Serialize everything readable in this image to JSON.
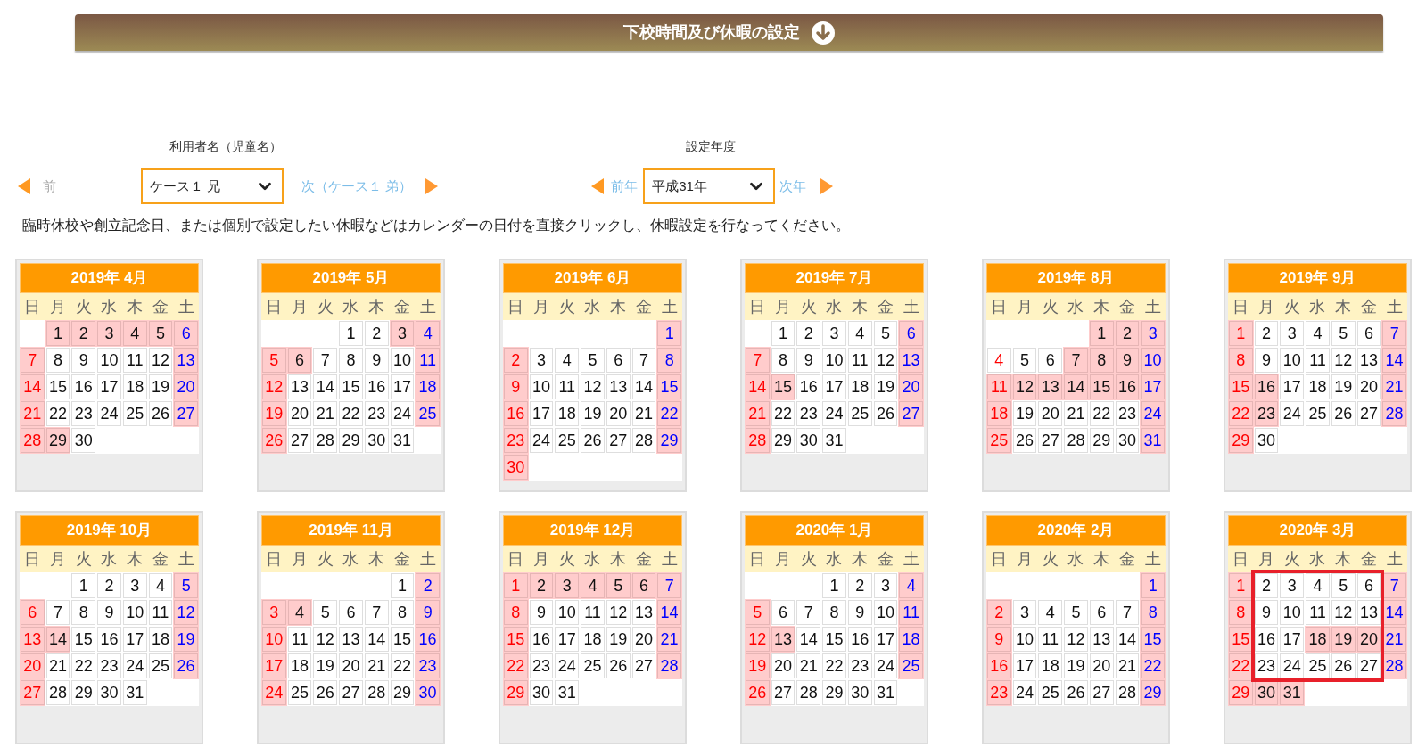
{
  "header": {
    "title": "下校時間及び休暇の設定"
  },
  "user": {
    "label": "利用者名（児童名）",
    "prev": "前",
    "value": "ケース１ 兄",
    "next": "次（ケース１ 弟）"
  },
  "year": {
    "label": "設定年度",
    "prev": "前年",
    "value": "平成31年",
    "next": "次年"
  },
  "instruction": "臨時休校や創立記念日、または個別で設定したい休暇などはカレンダーの日付を直接クリックし、休暇設定を行なってください。",
  "months": [
    {
      "title": "2019年 4月",
      "weekdays": [
        "日",
        "月",
        "火",
        "水",
        "木",
        "金",
        "土"
      ],
      "days": [
        {
          "kind": "blank"
        },
        {
          "kind": "day",
          "day": "1",
          "holiday": true
        },
        {
          "kind": "day",
          "day": "2",
          "holiday": true
        },
        {
          "kind": "day",
          "day": "3",
          "holiday": true
        },
        {
          "kind": "day",
          "day": "4",
          "holiday": true
        },
        {
          "kind": "day",
          "day": "5",
          "holiday": true
        },
        {
          "kind": "day",
          "day": "6",
          "holiday": true
        },
        {
          "kind": "day",
          "day": "7",
          "holiday": true
        },
        {
          "kind": "day",
          "day": "8",
          "holiday": false
        },
        {
          "kind": "day",
          "day": "9",
          "holiday": false
        },
        {
          "kind": "day",
          "day": "10",
          "holiday": false
        },
        {
          "kind": "day",
          "day": "11",
          "holiday": false
        },
        {
          "kind": "day",
          "day": "12",
          "holiday": false
        },
        {
          "kind": "day",
          "day": "13",
          "holiday": true
        },
        {
          "kind": "day",
          "day": "14",
          "holiday": true
        },
        {
          "kind": "day",
          "day": "15",
          "holiday": false
        },
        {
          "kind": "day",
          "day": "16",
          "holiday": false
        },
        {
          "kind": "day",
          "day": "17",
          "holiday": false
        },
        {
          "kind": "day",
          "day": "18",
          "holiday": false
        },
        {
          "kind": "day",
          "day": "19",
          "holiday": false
        },
        {
          "kind": "day",
          "day": "20",
          "holiday": true
        },
        {
          "kind": "day",
          "day": "21",
          "holiday": true
        },
        {
          "kind": "day",
          "day": "22",
          "holiday": false
        },
        {
          "kind": "day",
          "day": "23",
          "holiday": false
        },
        {
          "kind": "day",
          "day": "24",
          "holiday": false
        },
        {
          "kind": "day",
          "day": "25",
          "holiday": false
        },
        {
          "kind": "day",
          "day": "26",
          "holiday": false
        },
        {
          "kind": "day",
          "day": "27",
          "holiday": true
        },
        {
          "kind": "day",
          "day": "28",
          "holiday": true
        },
        {
          "kind": "day",
          "day": "29",
          "holiday": true
        },
        {
          "kind": "day",
          "day": "30",
          "holiday": false
        }
      ]
    },
    {
      "title": "2019年 5月",
      "weekdays": [
        "日",
        "月",
        "火",
        "水",
        "木",
        "金",
        "土"
      ],
      "days": [
        {
          "kind": "blank"
        },
        {
          "kind": "blank"
        },
        {
          "kind": "blank"
        },
        {
          "kind": "day",
          "day": "1",
          "holiday": false
        },
        {
          "kind": "day",
          "day": "2",
          "holiday": false
        },
        {
          "kind": "day",
          "day": "3",
          "holiday": true
        },
        {
          "kind": "day",
          "day": "4",
          "holiday": true
        },
        {
          "kind": "day",
          "day": "5",
          "holiday": true
        },
        {
          "kind": "day",
          "day": "6",
          "holiday": true
        },
        {
          "kind": "day",
          "day": "7",
          "holiday": false
        },
        {
          "kind": "day",
          "day": "8",
          "holiday": false
        },
        {
          "kind": "day",
          "day": "9",
          "holiday": false
        },
        {
          "kind": "day",
          "day": "10",
          "holiday": false
        },
        {
          "kind": "day",
          "day": "11",
          "holiday": true
        },
        {
          "kind": "day",
          "day": "12",
          "holiday": true
        },
        {
          "kind": "day",
          "day": "13",
          "holiday": false
        },
        {
          "kind": "day",
          "day": "14",
          "holiday": false
        },
        {
          "kind": "day",
          "day": "15",
          "holiday": false
        },
        {
          "kind": "day",
          "day": "16",
          "holiday": false
        },
        {
          "kind": "day",
          "day": "17",
          "holiday": false
        },
        {
          "kind": "day",
          "day": "18",
          "holiday": true
        },
        {
          "kind": "day",
          "day": "19",
          "holiday": true
        },
        {
          "kind": "day",
          "day": "20",
          "holiday": false
        },
        {
          "kind": "day",
          "day": "21",
          "holiday": false
        },
        {
          "kind": "day",
          "day": "22",
          "holiday": false
        },
        {
          "kind": "day",
          "day": "23",
          "holiday": false
        },
        {
          "kind": "day",
          "day": "24",
          "holiday": false
        },
        {
          "kind": "day",
          "day": "25",
          "holiday": true
        },
        {
          "kind": "day",
          "day": "26",
          "holiday": true
        },
        {
          "kind": "day",
          "day": "27",
          "holiday": false
        },
        {
          "kind": "day",
          "day": "28",
          "holiday": false
        },
        {
          "kind": "day",
          "day": "29",
          "holiday": false
        },
        {
          "kind": "day",
          "day": "30",
          "holiday": false
        },
        {
          "kind": "day",
          "day": "31",
          "holiday": false
        }
      ]
    },
    {
      "title": "2019年 6月",
      "weekdays": [
        "日",
        "月",
        "火",
        "水",
        "木",
        "金",
        "土"
      ],
      "days": [
        {
          "kind": "blank"
        },
        {
          "kind": "blank"
        },
        {
          "kind": "blank"
        },
        {
          "kind": "blank"
        },
        {
          "kind": "blank"
        },
        {
          "kind": "blank"
        },
        {
          "kind": "day",
          "day": "1",
          "holiday": true
        },
        {
          "kind": "day",
          "day": "2",
          "holiday": true
        },
        {
          "kind": "day",
          "day": "3",
          "holiday": false
        },
        {
          "kind": "day",
          "day": "4",
          "holiday": false
        },
        {
          "kind": "day",
          "day": "5",
          "holiday": false
        },
        {
          "kind": "day",
          "day": "6",
          "holiday": false
        },
        {
          "kind": "day",
          "day": "7",
          "holiday": false
        },
        {
          "kind": "day",
          "day": "8",
          "holiday": true
        },
        {
          "kind": "day",
          "day": "9",
          "holiday": true
        },
        {
          "kind": "day",
          "day": "10",
          "holiday": false
        },
        {
          "kind": "day",
          "day": "11",
          "holiday": false
        },
        {
          "kind": "day",
          "day": "12",
          "holiday": false
        },
        {
          "kind": "day",
          "day": "13",
          "holiday": false
        },
        {
          "kind": "day",
          "day": "14",
          "holiday": false
        },
        {
          "kind": "day",
          "day": "15",
          "holiday": true
        },
        {
          "kind": "day",
          "day": "16",
          "holiday": true
        },
        {
          "kind": "day",
          "day": "17",
          "holiday": false
        },
        {
          "kind": "day",
          "day": "18",
          "holiday": false
        },
        {
          "kind": "day",
          "day": "19",
          "holiday": false
        },
        {
          "kind": "day",
          "day": "20",
          "holiday": false
        },
        {
          "kind": "day",
          "day": "21",
          "holiday": false
        },
        {
          "kind": "day",
          "day": "22",
          "holiday": true
        },
        {
          "kind": "day",
          "day": "23",
          "holiday": true
        },
        {
          "kind": "day",
          "day": "24",
          "holiday": false
        },
        {
          "kind": "day",
          "day": "25",
          "holiday": false
        },
        {
          "kind": "day",
          "day": "26",
          "holiday": false
        },
        {
          "kind": "day",
          "day": "27",
          "holiday": false
        },
        {
          "kind": "day",
          "day": "28",
          "holiday": false
        },
        {
          "kind": "day",
          "day": "29",
          "holiday": true
        },
        {
          "kind": "day",
          "day": "30",
          "holiday": true
        }
      ]
    },
    {
      "title": "2019年 7月",
      "weekdays": [
        "日",
        "月",
        "火",
        "水",
        "木",
        "金",
        "土"
      ],
      "days": [
        {
          "kind": "blank"
        },
        {
          "kind": "day",
          "day": "1",
          "holiday": false
        },
        {
          "kind": "day",
          "day": "2",
          "holiday": false
        },
        {
          "kind": "day",
          "day": "3",
          "holiday": false
        },
        {
          "kind": "day",
          "day": "4",
          "holiday": false
        },
        {
          "kind": "day",
          "day": "5",
          "holiday": false
        },
        {
          "kind": "day",
          "day": "6",
          "holiday": true
        },
        {
          "kind": "day",
          "day": "7",
          "holiday": true
        },
        {
          "kind": "day",
          "day": "8",
          "holiday": false
        },
        {
          "kind": "day",
          "day": "9",
          "holiday": false
        },
        {
          "kind": "day",
          "day": "10",
          "holiday": false
        },
        {
          "kind": "day",
          "day": "11",
          "holiday": false
        },
        {
          "kind": "day",
          "day": "12",
          "holiday": false
        },
        {
          "kind": "day",
          "day": "13",
          "holiday": true
        },
        {
          "kind": "day",
          "day": "14",
          "holiday": true
        },
        {
          "kind": "day",
          "day": "15",
          "holiday": true
        },
        {
          "kind": "day",
          "day": "16",
          "holiday": false
        },
        {
          "kind": "day",
          "day": "17",
          "holiday": false
        },
        {
          "kind": "day",
          "day": "18",
          "holiday": false
        },
        {
          "kind": "day",
          "day": "19",
          "holiday": false
        },
        {
          "kind": "day",
          "day": "20",
          "holiday": true
        },
        {
          "kind": "day",
          "day": "21",
          "holiday": true
        },
        {
          "kind": "day",
          "day": "22",
          "holiday": false
        },
        {
          "kind": "day",
          "day": "23",
          "holiday": false
        },
        {
          "kind": "day",
          "day": "24",
          "holiday": false
        },
        {
          "kind": "day",
          "day": "25",
          "holiday": false
        },
        {
          "kind": "day",
          "day": "26",
          "holiday": false
        },
        {
          "kind": "day",
          "day": "27",
          "holiday": true
        },
        {
          "kind": "day",
          "day": "28",
          "holiday": true
        },
        {
          "kind": "day",
          "day": "29",
          "holiday": false
        },
        {
          "kind": "day",
          "day": "30",
          "holiday": false
        },
        {
          "kind": "day",
          "day": "31",
          "holiday": false
        }
      ]
    },
    {
      "title": "2019年 8月",
      "weekdays": [
        "日",
        "月",
        "火",
        "水",
        "木",
        "金",
        "土"
      ],
      "days": [
        {
          "kind": "blank"
        },
        {
          "kind": "blank"
        },
        {
          "kind": "blank"
        },
        {
          "kind": "blank"
        },
        {
          "kind": "day",
          "day": "1",
          "holiday": true
        },
        {
          "kind": "day",
          "day": "2",
          "holiday": true
        },
        {
          "kind": "day",
          "day": "3",
          "holiday": true
        },
        {
          "kind": "day",
          "day": "4",
          "holiday": false
        },
        {
          "kind": "day",
          "day": "5",
          "holiday": false
        },
        {
          "kind": "day",
          "day": "6",
          "holiday": false
        },
        {
          "kind": "day",
          "day": "7",
          "holiday": true
        },
        {
          "kind": "day",
          "day": "8",
          "holiday": true
        },
        {
          "kind": "day",
          "day": "9",
          "holiday": true
        },
        {
          "kind": "day",
          "day": "10",
          "holiday": true
        },
        {
          "kind": "day",
          "day": "11",
          "holiday": true
        },
        {
          "kind": "day",
          "day": "12",
          "holiday": true
        },
        {
          "kind": "day",
          "day": "13",
          "holiday": true
        },
        {
          "kind": "day",
          "day": "14",
          "holiday": true
        },
        {
          "kind": "day",
          "day": "15",
          "holiday": true
        },
        {
          "kind": "day",
          "day": "16",
          "holiday": true
        },
        {
          "kind": "day",
          "day": "17",
          "holiday": true
        },
        {
          "kind": "day",
          "day": "18",
          "holiday": true
        },
        {
          "kind": "day",
          "day": "19",
          "holiday": false
        },
        {
          "kind": "day",
          "day": "20",
          "holiday": false
        },
        {
          "kind": "day",
          "day": "21",
          "holiday": false
        },
        {
          "kind": "day",
          "day": "22",
          "holiday": false
        },
        {
          "kind": "day",
          "day": "23",
          "holiday": false
        },
        {
          "kind": "day",
          "day": "24",
          "holiday": true
        },
        {
          "kind": "day",
          "day": "25",
          "holiday": true
        },
        {
          "kind": "day",
          "day": "26",
          "holiday": false
        },
        {
          "kind": "day",
          "day": "27",
          "holiday": false
        },
        {
          "kind": "day",
          "day": "28",
          "holiday": false
        },
        {
          "kind": "day",
          "day": "29",
          "holiday": false
        },
        {
          "kind": "day",
          "day": "30",
          "holiday": false
        },
        {
          "kind": "day",
          "day": "31",
          "holiday": true
        }
      ]
    },
    {
      "title": "2019年 9月",
      "weekdays": [
        "日",
        "月",
        "火",
        "水",
        "木",
        "金",
        "土"
      ],
      "days": [
        {
          "kind": "day",
          "day": "1",
          "holiday": true
        },
        {
          "kind": "day",
          "day": "2",
          "holiday": false
        },
        {
          "kind": "day",
          "day": "3",
          "holiday": false
        },
        {
          "kind": "day",
          "day": "4",
          "holiday": false
        },
        {
          "kind": "day",
          "day": "5",
          "holiday": false
        },
        {
          "kind": "day",
          "day": "6",
          "holiday": false
        },
        {
          "kind": "day",
          "day": "7",
          "holiday": true
        },
        {
          "kind": "day",
          "day": "8",
          "holiday": true
        },
        {
          "kind": "day",
          "day": "9",
          "holiday": false
        },
        {
          "kind": "day",
          "day": "10",
          "holiday": false
        },
        {
          "kind": "day",
          "day": "11",
          "holiday": false
        },
        {
          "kind": "day",
          "day": "12",
          "holiday": false
        },
        {
          "kind": "day",
          "day": "13",
          "holiday": false
        },
        {
          "kind": "day",
          "day": "14",
          "holiday": true
        },
        {
          "kind": "day",
          "day": "15",
          "holiday": true
        },
        {
          "kind": "day",
          "day": "16",
          "holiday": true
        },
        {
          "kind": "day",
          "day": "17",
          "holiday": false
        },
        {
          "kind": "day",
          "day": "18",
          "holiday": false
        },
        {
          "kind": "day",
          "day": "19",
          "holiday": false
        },
        {
          "kind": "day",
          "day": "20",
          "holiday": false
        },
        {
          "kind": "day",
          "day": "21",
          "holiday": true
        },
        {
          "kind": "day",
          "day": "22",
          "holiday": true
        },
        {
          "kind": "day",
          "day": "23",
          "holiday": true
        },
        {
          "kind": "day",
          "day": "24",
          "holiday": false
        },
        {
          "kind": "day",
          "day": "25",
          "holiday": false
        },
        {
          "kind": "day",
          "day": "26",
          "holiday": false
        },
        {
          "kind": "day",
          "day": "27",
          "holiday": false
        },
        {
          "kind": "day",
          "day": "28",
          "holiday": true
        },
        {
          "kind": "day",
          "day": "29",
          "holiday": true
        },
        {
          "kind": "day",
          "day": "30",
          "holiday": false
        }
      ]
    },
    {
      "title": "2019年 10月",
      "weekdays": [
        "日",
        "月",
        "火",
        "水",
        "木",
        "金",
        "土"
      ],
      "days": [
        {
          "kind": "blank"
        },
        {
          "kind": "blank"
        },
        {
          "kind": "day",
          "day": "1",
          "holiday": false
        },
        {
          "kind": "day",
          "day": "2",
          "holiday": false
        },
        {
          "kind": "day",
          "day": "3",
          "holiday": false
        },
        {
          "kind": "day",
          "day": "4",
          "holiday": false
        },
        {
          "kind": "day",
          "day": "5",
          "holiday": true
        },
        {
          "kind": "day",
          "day": "6",
          "holiday": true
        },
        {
          "kind": "day",
          "day": "7",
          "holiday": false
        },
        {
          "kind": "day",
          "day": "8",
          "holiday": false
        },
        {
          "kind": "day",
          "day": "9",
          "holiday": false
        },
        {
          "kind": "day",
          "day": "10",
          "holiday": false
        },
        {
          "kind": "day",
          "day": "11",
          "holiday": false
        },
        {
          "kind": "day",
          "day": "12",
          "holiday": true
        },
        {
          "kind": "day",
          "day": "13",
          "holiday": true
        },
        {
          "kind": "day",
          "day": "14",
          "holiday": true
        },
        {
          "kind": "day",
          "day": "15",
          "holiday": false
        },
        {
          "kind": "day",
          "day": "16",
          "holiday": false
        },
        {
          "kind": "day",
          "day": "17",
          "holiday": false
        },
        {
          "kind": "day",
          "day": "18",
          "holiday": false
        },
        {
          "kind": "day",
          "day": "19",
          "holiday": true
        },
        {
          "kind": "day",
          "day": "20",
          "holiday": true
        },
        {
          "kind": "day",
          "day": "21",
          "holiday": false
        },
        {
          "kind": "day",
          "day": "22",
          "holiday": false
        },
        {
          "kind": "day",
          "day": "23",
          "holiday": false
        },
        {
          "kind": "day",
          "day": "24",
          "holiday": false
        },
        {
          "kind": "day",
          "day": "25",
          "holiday": false
        },
        {
          "kind": "day",
          "day": "26",
          "holiday": true
        },
        {
          "kind": "day",
          "day": "27",
          "holiday": true
        },
        {
          "kind": "day",
          "day": "28",
          "holiday": false
        },
        {
          "kind": "day",
          "day": "29",
          "holiday": false
        },
        {
          "kind": "day",
          "day": "30",
          "holiday": false
        },
        {
          "kind": "day",
          "day": "31",
          "holiday": false
        }
      ]
    },
    {
      "title": "2019年 11月",
      "weekdays": [
        "日",
        "月",
        "火",
        "水",
        "木",
        "金",
        "土"
      ],
      "days": [
        {
          "kind": "blank"
        },
        {
          "kind": "blank"
        },
        {
          "kind": "blank"
        },
        {
          "kind": "blank"
        },
        {
          "kind": "blank"
        },
        {
          "kind": "day",
          "day": "1",
          "holiday": false
        },
        {
          "kind": "day",
          "day": "2",
          "holiday": true
        },
        {
          "kind": "day",
          "day": "3",
          "holiday": true
        },
        {
          "kind": "day",
          "day": "4",
          "holiday": true
        },
        {
          "kind": "day",
          "day": "5",
          "holiday": false
        },
        {
          "kind": "day",
          "day": "6",
          "holiday": false
        },
        {
          "kind": "day",
          "day": "7",
          "holiday": false
        },
        {
          "kind": "day",
          "day": "8",
          "holiday": false
        },
        {
          "kind": "day",
          "day": "9",
          "holiday": true
        },
        {
          "kind": "day",
          "day": "10",
          "holiday": true
        },
        {
          "kind": "day",
          "day": "11",
          "holiday": false
        },
        {
          "kind": "day",
          "day": "12",
          "holiday": false
        },
        {
          "kind": "day",
          "day": "13",
          "holiday": false
        },
        {
          "kind": "day",
          "day": "14",
          "holiday": false
        },
        {
          "kind": "day",
          "day": "15",
          "holiday": false
        },
        {
          "kind": "day",
          "day": "16",
          "holiday": true
        },
        {
          "kind": "day",
          "day": "17",
          "holiday": true
        },
        {
          "kind": "day",
          "day": "18",
          "holiday": false
        },
        {
          "kind": "day",
          "day": "19",
          "holiday": false
        },
        {
          "kind": "day",
          "day": "20",
          "holiday": false
        },
        {
          "kind": "day",
          "day": "21",
          "holiday": false
        },
        {
          "kind": "day",
          "day": "22",
          "holiday": false
        },
        {
          "kind": "day",
          "day": "23",
          "holiday": true
        },
        {
          "kind": "day",
          "day": "24",
          "holiday": true
        },
        {
          "kind": "day",
          "day": "25",
          "holiday": false
        },
        {
          "kind": "day",
          "day": "26",
          "holiday": false
        },
        {
          "kind": "day",
          "day": "27",
          "holiday": false
        },
        {
          "kind": "day",
          "day": "28",
          "holiday": false
        },
        {
          "kind": "day",
          "day": "29",
          "holiday": false
        },
        {
          "kind": "day",
          "day": "30",
          "holiday": true
        }
      ]
    },
    {
      "title": "2019年 12月",
      "weekdays": [
        "日",
        "月",
        "火",
        "水",
        "木",
        "金",
        "土"
      ],
      "days": [
        {
          "kind": "day",
          "day": "1",
          "holiday": true
        },
        {
          "kind": "day",
          "day": "2",
          "holiday": true
        },
        {
          "kind": "day",
          "day": "3",
          "holiday": true
        },
        {
          "kind": "day",
          "day": "4",
          "holiday": true
        },
        {
          "kind": "day",
          "day": "5",
          "holiday": true
        },
        {
          "kind": "day",
          "day": "6",
          "holiday": true
        },
        {
          "kind": "day",
          "day": "7",
          "holiday": true
        },
        {
          "kind": "day",
          "day": "8",
          "holiday": true
        },
        {
          "kind": "day",
          "day": "9",
          "holiday": false
        },
        {
          "kind": "day",
          "day": "10",
          "holiday": false
        },
        {
          "kind": "day",
          "day": "11",
          "holiday": false
        },
        {
          "kind": "day",
          "day": "12",
          "holiday": false
        },
        {
          "kind": "day",
          "day": "13",
          "holiday": false
        },
        {
          "kind": "day",
          "day": "14",
          "holiday": true
        },
        {
          "kind": "day",
          "day": "15",
          "holiday": true
        },
        {
          "kind": "day",
          "day": "16",
          "holiday": false
        },
        {
          "kind": "day",
          "day": "17",
          "holiday": false
        },
        {
          "kind": "day",
          "day": "18",
          "holiday": false
        },
        {
          "kind": "day",
          "day": "19",
          "holiday": false
        },
        {
          "kind": "day",
          "day": "20",
          "holiday": false
        },
        {
          "kind": "day",
          "day": "21",
          "holiday": true
        },
        {
          "kind": "day",
          "day": "22",
          "holiday": true
        },
        {
          "kind": "day",
          "day": "23",
          "holiday": false
        },
        {
          "kind": "day",
          "day": "24",
          "holiday": false
        },
        {
          "kind": "day",
          "day": "25",
          "holiday": false
        },
        {
          "kind": "day",
          "day": "26",
          "holiday": false
        },
        {
          "kind": "day",
          "day": "27",
          "holiday": false
        },
        {
          "kind": "day",
          "day": "28",
          "holiday": true
        },
        {
          "kind": "day",
          "day": "29",
          "holiday": true
        },
        {
          "kind": "day",
          "day": "30",
          "holiday": false
        },
        {
          "kind": "day",
          "day": "31",
          "holiday": false
        }
      ]
    },
    {
      "title": "2020年 1月",
      "weekdays": [
        "日",
        "月",
        "火",
        "水",
        "木",
        "金",
        "土"
      ],
      "days": [
        {
          "kind": "blank"
        },
        {
          "kind": "blank"
        },
        {
          "kind": "blank"
        },
        {
          "kind": "day",
          "day": "1",
          "holiday": false
        },
        {
          "kind": "day",
          "day": "2",
          "holiday": false
        },
        {
          "kind": "day",
          "day": "3",
          "holiday": false
        },
        {
          "kind": "day",
          "day": "4",
          "holiday": true
        },
        {
          "kind": "day",
          "day": "5",
          "holiday": true
        },
        {
          "kind": "day",
          "day": "6",
          "holiday": false
        },
        {
          "kind": "day",
          "day": "7",
          "holiday": false
        },
        {
          "kind": "day",
          "day": "8",
          "holiday": false
        },
        {
          "kind": "day",
          "day": "9",
          "holiday": false
        },
        {
          "kind": "day",
          "day": "10",
          "holiday": false
        },
        {
          "kind": "day",
          "day": "11",
          "holiday": true
        },
        {
          "kind": "day",
          "day": "12",
          "holiday": true
        },
        {
          "kind": "day",
          "day": "13",
          "holiday": true
        },
        {
          "kind": "day",
          "day": "14",
          "holiday": false
        },
        {
          "kind": "day",
          "day": "15",
          "holiday": false
        },
        {
          "kind": "day",
          "day": "16",
          "holiday": false
        },
        {
          "kind": "day",
          "day": "17",
          "holiday": false
        },
        {
          "kind": "day",
          "day": "18",
          "holiday": true
        },
        {
          "kind": "day",
          "day": "19",
          "holiday": true
        },
        {
          "kind": "day",
          "day": "20",
          "holiday": false
        },
        {
          "kind": "day",
          "day": "21",
          "holiday": false
        },
        {
          "kind": "day",
          "day": "22",
          "holiday": false
        },
        {
          "kind": "day",
          "day": "23",
          "holiday": false
        },
        {
          "kind": "day",
          "day": "24",
          "holiday": false
        },
        {
          "kind": "day",
          "day": "25",
          "holiday": true
        },
        {
          "kind": "day",
          "day": "26",
          "holiday": true
        },
        {
          "kind": "day",
          "day": "27",
          "holiday": false
        },
        {
          "kind": "day",
          "day": "28",
          "holiday": false
        },
        {
          "kind": "day",
          "day": "29",
          "holiday": false
        },
        {
          "kind": "day",
          "day": "30",
          "holiday": false
        },
        {
          "kind": "day",
          "day": "31",
          "holiday": false
        }
      ]
    },
    {
      "title": "2020年 2月",
      "weekdays": [
        "日",
        "月",
        "火",
        "水",
        "木",
        "金",
        "土"
      ],
      "days": [
        {
          "kind": "blank"
        },
        {
          "kind": "blank"
        },
        {
          "kind": "blank"
        },
        {
          "kind": "blank"
        },
        {
          "kind": "blank"
        },
        {
          "kind": "blank"
        },
        {
          "kind": "day",
          "day": "1",
          "holiday": true
        },
        {
          "kind": "day",
          "day": "2",
          "holiday": true
        },
        {
          "kind": "day",
          "day": "3",
          "holiday": false
        },
        {
          "kind": "day",
          "day": "4",
          "holiday": false
        },
        {
          "kind": "day",
          "day": "5",
          "holiday": false
        },
        {
          "kind": "day",
          "day": "6",
          "holiday": false
        },
        {
          "kind": "day",
          "day": "7",
          "holiday": false
        },
        {
          "kind": "day",
          "day": "8",
          "holiday": true
        },
        {
          "kind": "day",
          "day": "9",
          "holiday": true
        },
        {
          "kind": "day",
          "day": "10",
          "holiday": false
        },
        {
          "kind": "day",
          "day": "11",
          "holiday": false
        },
        {
          "kind": "day",
          "day": "12",
          "holiday": false
        },
        {
          "kind": "day",
          "day": "13",
          "holiday": false
        },
        {
          "kind": "day",
          "day": "14",
          "holiday": false
        },
        {
          "kind": "day",
          "day": "15",
          "holiday": true
        },
        {
          "kind": "day",
          "day": "16",
          "holiday": true
        },
        {
          "kind": "day",
          "day": "17",
          "holiday": false
        },
        {
          "kind": "day",
          "day": "18",
          "holiday": false
        },
        {
          "kind": "day",
          "day": "19",
          "holiday": false
        },
        {
          "kind": "day",
          "day": "20",
          "holiday": false
        },
        {
          "kind": "day",
          "day": "21",
          "holiday": false
        },
        {
          "kind": "day",
          "day": "22",
          "holiday": true
        },
        {
          "kind": "day",
          "day": "23",
          "holiday": true
        },
        {
          "kind": "day",
          "day": "24",
          "holiday": false
        },
        {
          "kind": "day",
          "day": "25",
          "holiday": false
        },
        {
          "kind": "day",
          "day": "26",
          "holiday": false
        },
        {
          "kind": "day",
          "day": "27",
          "holiday": false
        },
        {
          "kind": "day",
          "day": "28",
          "holiday": false
        },
        {
          "kind": "day",
          "day": "29",
          "holiday": true
        }
      ]
    },
    {
      "title": "2020年 3月",
      "annotation": {
        "kind": "frame"
      },
      "weekdays": [
        "日",
        "月",
        "火",
        "水",
        "木",
        "金",
        "土"
      ],
      "days": [
        {
          "kind": "day",
          "day": "1",
          "holiday": true
        },
        {
          "kind": "day",
          "day": "2",
          "holiday": false
        },
        {
          "kind": "day",
          "day": "3",
          "holiday": false
        },
        {
          "kind": "day",
          "day": "4",
          "holiday": false
        },
        {
          "kind": "day",
          "day": "5",
          "holiday": false
        },
        {
          "kind": "day",
          "day": "6",
          "holiday": false
        },
        {
          "kind": "day",
          "day": "7",
          "holiday": true
        },
        {
          "kind": "day",
          "day": "8",
          "holiday": true
        },
        {
          "kind": "day",
          "day": "9",
          "holiday": false
        },
        {
          "kind": "day",
          "day": "10",
          "holiday": false
        },
        {
          "kind": "day",
          "day": "11",
          "holiday": false
        },
        {
          "kind": "day",
          "day": "12",
          "holiday": false
        },
        {
          "kind": "day",
          "day": "13",
          "holiday": false
        },
        {
          "kind": "day",
          "day": "14",
          "holiday": true
        },
        {
          "kind": "day",
          "day": "15",
          "holiday": true
        },
        {
          "kind": "day",
          "day": "16",
          "holiday": false
        },
        {
          "kind": "day",
          "day": "17",
          "holiday": false
        },
        {
          "kind": "day",
          "day": "18",
          "holiday": true
        },
        {
          "kind": "day",
          "day": "19",
          "holiday": true
        },
        {
          "kind": "day",
          "day": "20",
          "holiday": true
        },
        {
          "kind": "day",
          "day": "21",
          "holiday": true
        },
        {
          "kind": "day",
          "day": "22",
          "holiday": true
        },
        {
          "kind": "day",
          "day": "23",
          "holiday": false
        },
        {
          "kind": "day",
          "day": "24",
          "holiday": false
        },
        {
          "kind": "day",
          "day": "25",
          "holiday": false
        },
        {
          "kind": "day",
          "day": "26",
          "holiday": false
        },
        {
          "kind": "day",
          "day": "27",
          "holiday": false
        },
        {
          "kind": "day",
          "day": "28",
          "holiday": true
        },
        {
          "kind": "day",
          "day": "29",
          "holiday": true
        },
        {
          "kind": "day",
          "day": "30",
          "holiday": true
        },
        {
          "kind": "day",
          "day": "31",
          "holiday": true
        }
      ]
    }
  ]
}
